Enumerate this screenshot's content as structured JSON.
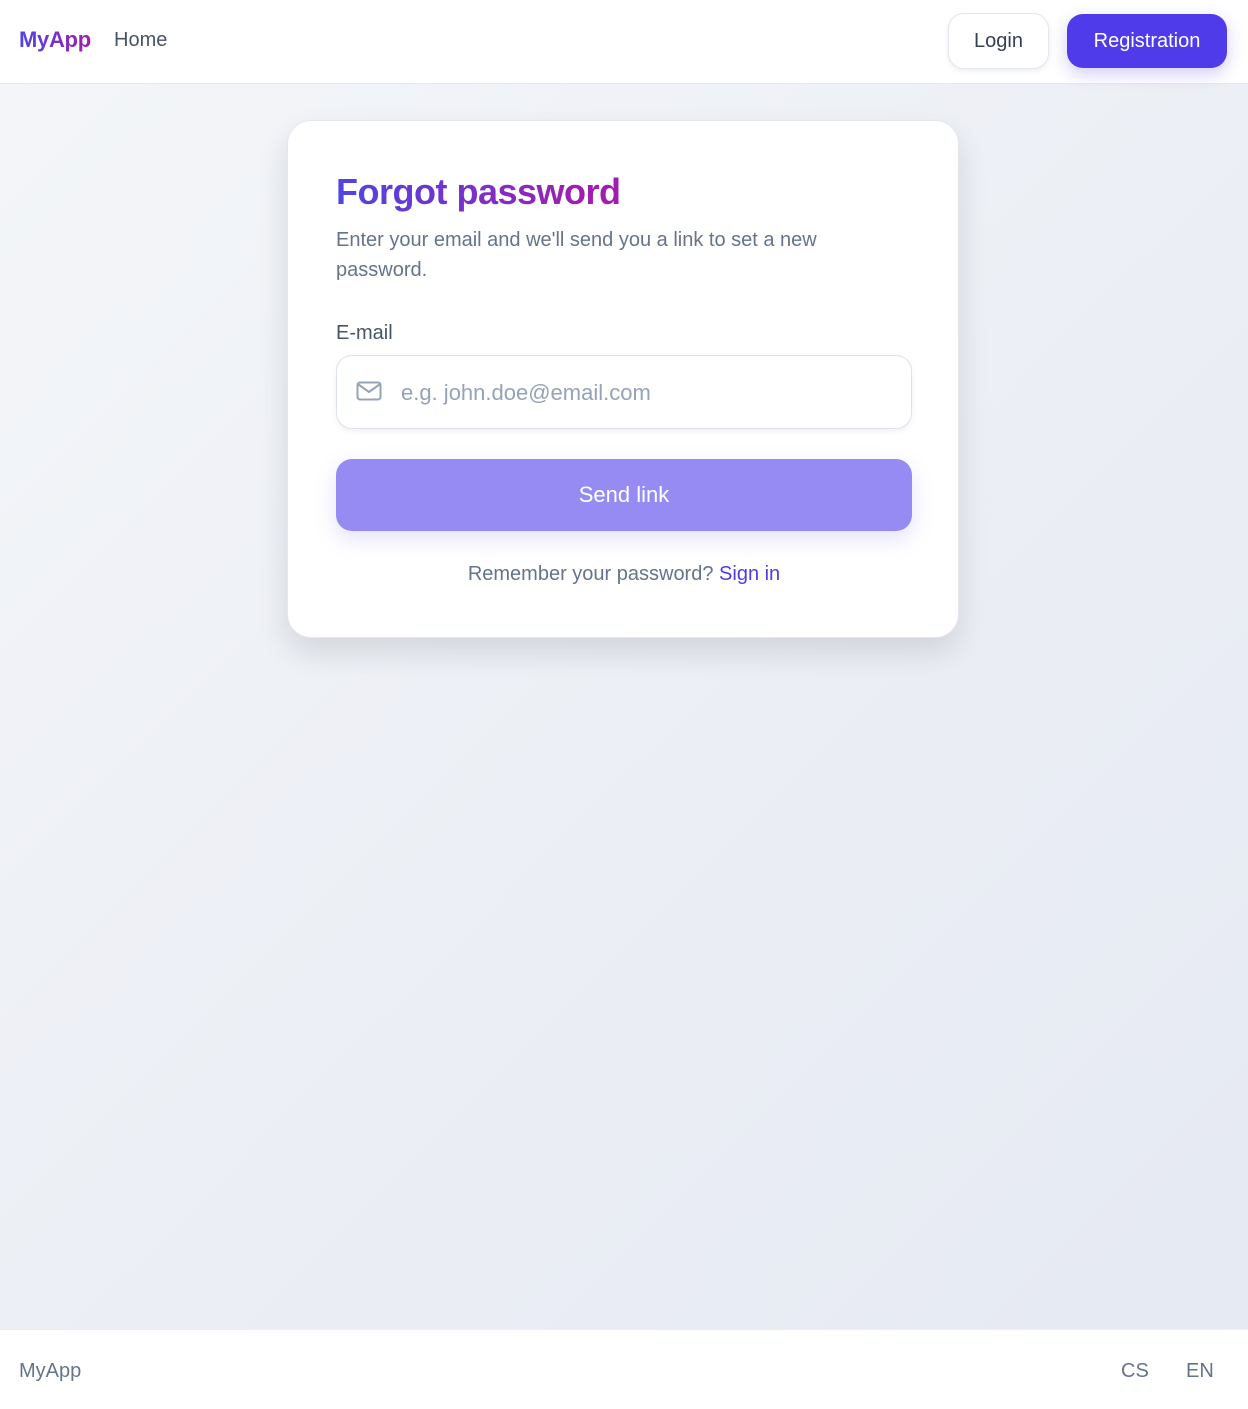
{
  "header": {
    "brand": "MyApp",
    "nav_home": "Home",
    "login_label": "Login",
    "register_label": "Registration"
  },
  "card": {
    "title": "Forgot password",
    "subtitle": "Enter your email and we'll send you a link to set a new password.",
    "email_label": "E-mail",
    "email_placeholder": "e.g. john.doe@email.com",
    "email_value": "",
    "send_label": "Send link",
    "remember_text": "Remember your password?",
    "signin_label": "Sign in"
  },
  "footer": {
    "brand": "MyApp",
    "languages": [
      "CS",
      "EN"
    ]
  },
  "icons": {
    "email_field": "mail-icon"
  },
  "colors": {
    "primary": "#4f3bea",
    "button_disabled": "#968bf3",
    "brand_gradient_start": "#4f46e5",
    "brand_gradient_end": "#a21caf"
  }
}
